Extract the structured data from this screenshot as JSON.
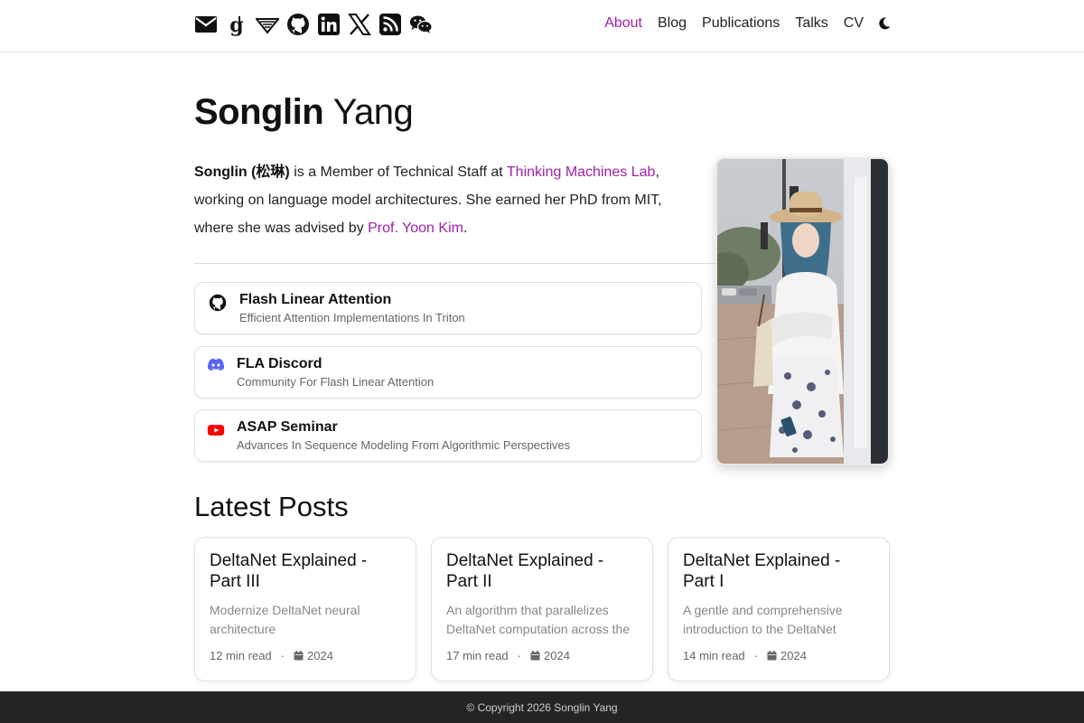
{
  "header": {
    "social_icons": [
      "envelope-icon",
      "google-scholar-icon",
      "semantic-scholar-icon",
      "github-icon",
      "linkedin-icon",
      "x-twitter-icon",
      "rss-icon",
      "wechat-icon"
    ],
    "nav": {
      "about": "About",
      "blog": "Blog",
      "publications": "Publications",
      "talks": "Talks",
      "cv": "CV"
    },
    "theme_toggle_icon": "moon-icon",
    "accent_color": "#a020a8"
  },
  "profile": {
    "first_name": "Songlin",
    "last_name": "Yang",
    "bio": {
      "name_bold": "Songlin (松琳)",
      "text1": " is a Member of Technical Staff at ",
      "org_link": "Thinking Machines Lab",
      "text2": ", working on language model architectures. She earned her PhD from MIT, where she was advised by ",
      "advisor_link": "Prof. Yoon Kim",
      "text3": "."
    }
  },
  "links": [
    {
      "icon": "github-icon",
      "title": "Flash Linear Attention",
      "subtitle": "Efficient Attention Implementations In Triton"
    },
    {
      "icon": "discord-icon",
      "title": "FLA Discord",
      "subtitle": "Community For Flash Linear Attention"
    },
    {
      "icon": "youtube-icon",
      "title": "ASAP Seminar",
      "subtitle": "Advances In Sequence Modeling From Algorithmic Perspectives"
    }
  ],
  "posts_section": {
    "title": "Latest Posts",
    "posts": [
      {
        "title": "DeltaNet Explained - Part III",
        "description": "Modernize DeltaNet neural architecture",
        "read_time": "12 min read",
        "year": "2024"
      },
      {
        "title": "DeltaNet Explained - Part II",
        "description": "An algorithm that parallelizes DeltaNet computation across the sequence length dimension",
        "read_time": "17 min read",
        "year": "2024"
      },
      {
        "title": "DeltaNet Explained - Part I",
        "description": "A gentle and comprehensive introduction to the DeltaNet",
        "read_time": "14 min read",
        "year": "2024"
      }
    ]
  },
  "footer": {
    "copyright": "© Copyright 2026 Songlin Yang"
  }
}
